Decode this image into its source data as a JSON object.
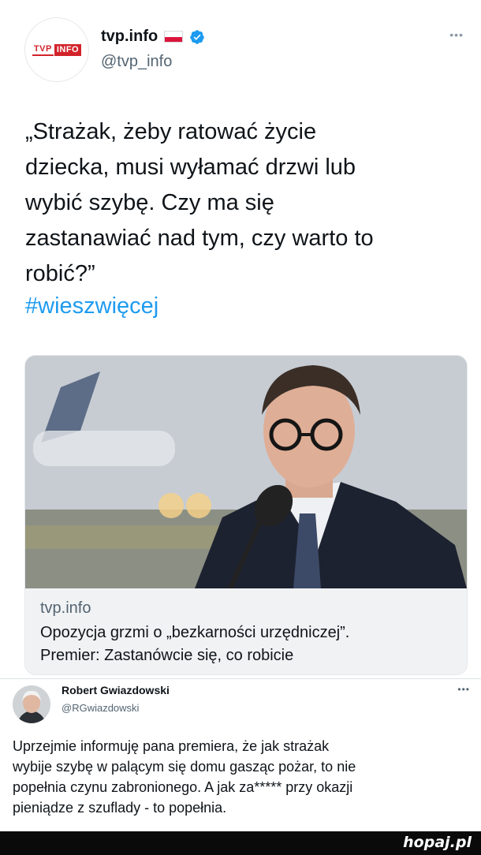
{
  "tweet_main": {
    "display_name": "tvp.info",
    "handle": "@tvp_info",
    "avatar_logo": {
      "left": "TVP",
      "right": "INFO"
    },
    "more_label": "•••",
    "text_lines": [
      "„Strażak, żeby ratować życie",
      "dziecka, musi wyłamać drzwi lub",
      "wybić szybę. Czy ma się",
      "zastanawiać nad tym, czy warto to",
      "robić?”"
    ],
    "hashtag": "#wieszwięcej",
    "link_card": {
      "domain": "tvp.info",
      "title_lines": [
        "Opozycja grzmi o „bezkarności urzędniczej”.",
        "Premier: Zastanówcie się, co robicie"
      ]
    }
  },
  "tweet_reply": {
    "display_name": "Robert Gwiazdowski",
    "handle": "@RGwiazdowski",
    "more_label": "•••",
    "text_lines": [
      "Uprzejmie informuję pana premiera, że jak strażak",
      "wybije szybę w palącym się domu gasząc pożar, to nie",
      "popełnia czynu zabronionego. A jak za***** przy okazji",
      "pieniądze z szuflady - to popełnia."
    ]
  },
  "watermark": "hopaj.pl",
  "colors": {
    "hashtag": "#1d9bf0",
    "text_primary": "#0f1419",
    "text_secondary": "#536471",
    "verified": "#1d9bf0",
    "tvp_red": "#d2232a"
  },
  "icons": {
    "verified": "verified-badge-icon",
    "flag": "poland-flag-icon",
    "more": "more-options-icon"
  }
}
